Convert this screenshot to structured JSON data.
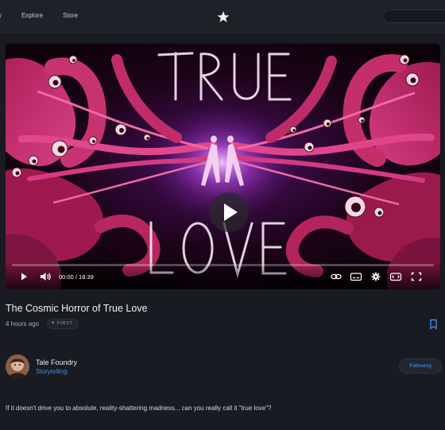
{
  "nav": {
    "items": [
      "y",
      "Explore",
      "Store"
    ],
    "logo_icon": "star-logo-icon"
  },
  "video": {
    "overlay_title_top": "TRUE",
    "overlay_title_bottom": "LOVE",
    "current_time": "00:00",
    "duration": "18:39",
    "time_display": "00:00 / 18:39",
    "progress_fraction": 0,
    "controls": [
      "play-icon",
      "volume-icon",
      "loop-icon",
      "captions-icon",
      "settings-icon",
      "theater-mode-icon",
      "fullscreen-icon"
    ]
  },
  "post": {
    "title": "The Cosmic Horror of True Love",
    "posted": "4 hours ago",
    "badge": "FIRST"
  },
  "channel": {
    "name": "Tale Foundry",
    "category": "Storytelling",
    "follow_label": "Following"
  },
  "description": "If it doesn't drive you to absolute, reality-shattering madness... can you really call it \"true love\"?",
  "colors": {
    "accent": "#3f8de0",
    "background": "#181b21",
    "art_pink": "#d22f7a"
  }
}
